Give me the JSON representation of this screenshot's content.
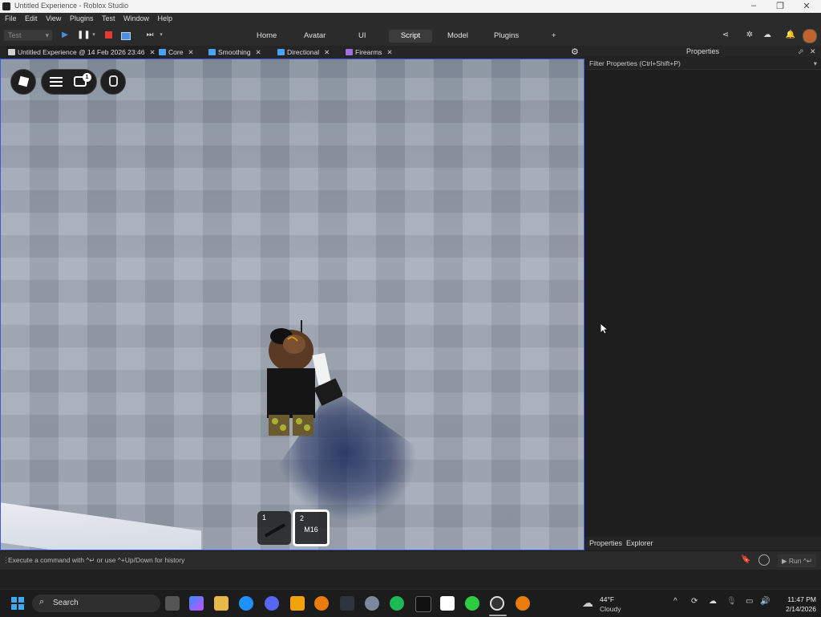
{
  "window": {
    "title": "Untitled Experience - Roblox Studio",
    "controls": [
      "–",
      "❐",
      "✕"
    ]
  },
  "menubar": [
    "File",
    "Edit",
    "View",
    "Plugins",
    "Test",
    "Window",
    "Help"
  ],
  "toolbar": {
    "mode_select": "Test",
    "tabs": [
      {
        "label": "Home",
        "active": false
      },
      {
        "label": "Avatar",
        "active": false
      },
      {
        "label": "UI",
        "active": false
      },
      {
        "label": "Script",
        "active": true
      },
      {
        "label": "Model",
        "active": false
      },
      {
        "label": "Plugins",
        "active": false
      }
    ],
    "add_tab": "+"
  },
  "doc_tabs": [
    {
      "label": "Untitled Experience @ 14 Feb 2026 23:46",
      "active": true,
      "color": "#cfcfcf"
    },
    {
      "label": "Core",
      "active": false,
      "color": "#4aa3ff"
    },
    {
      "label": "Smoothing",
      "active": false,
      "color": "#4aa3ff"
    },
    {
      "label": "Directional",
      "active": false,
      "color": "#4aa3ff"
    },
    {
      "label": "Firearms",
      "active": false,
      "color": "#a070e0"
    }
  ],
  "viewport": {
    "chat_badge": "1",
    "hotbar": [
      {
        "num": "1",
        "label": "",
        "selected": false
      },
      {
        "num": "2",
        "label": "M16",
        "selected": true
      }
    ]
  },
  "properties": {
    "title": "Properties",
    "filter_placeholder": "Filter Properties (Ctrl+Shift+P)",
    "bottom_tabs": [
      "Properties",
      "Explorer"
    ]
  },
  "command_bar": {
    "placeholder": "Execute a command with ^↵ or use ^+Up/Down for history",
    "run_label": "Run ^↵"
  },
  "taskbar": {
    "search_label": "Search",
    "weather_temp": "44°F",
    "weather_desc": "Cloudy",
    "time": "11:47 PM",
    "date": "2/14/2026"
  },
  "colors": {
    "viewport_border": "#3b5bdb",
    "record_red": "#e53935",
    "play_blue": "#4a90e2"
  }
}
